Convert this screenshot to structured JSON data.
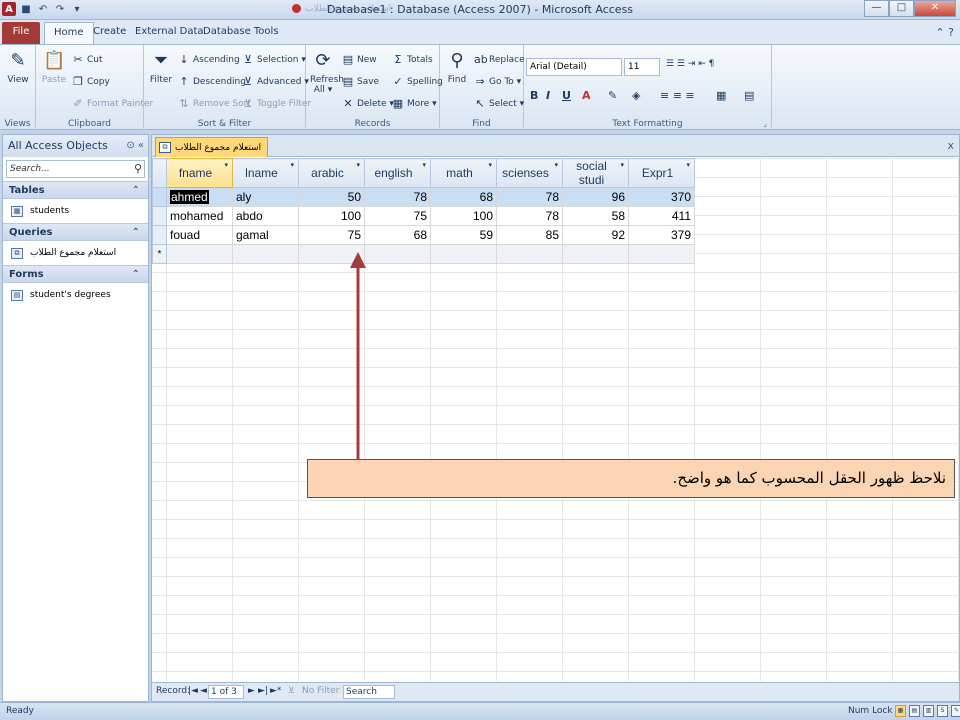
{
  "window": {
    "title": "Database1 : Database (Access 2007)  -  Microsoft Access",
    "title_ghost": "استعلام مجموع الطلاب",
    "min_glyph": "—",
    "max_glyph": "□",
    "close_glyph": "✕"
  },
  "tabs": {
    "file": "File",
    "home": "Home",
    "create": "Create",
    "external": "External Data",
    "dbtools": "Database Tools"
  },
  "ribbon": {
    "views": {
      "view": "View",
      "group": "Views"
    },
    "clipboard": {
      "paste": "Paste",
      "cut": "Cut",
      "copy": "Copy",
      "format_painter": "Format Painter",
      "group": "Clipboard"
    },
    "sort_filter": {
      "filter": "Filter",
      "ascending": "Ascending",
      "descending": "Descending",
      "remove_sort": "Remove Sort",
      "selection": "Selection ▾",
      "advanced": "Advanced ▾",
      "toggle_filter": "Toggle Filter",
      "group": "Sort & Filter"
    },
    "records": {
      "refresh": "Refresh",
      "refresh_all": "All ▾",
      "new": "New",
      "save": "Save",
      "delete": "Delete ▾",
      "totals": "Totals",
      "spelling": "Spelling",
      "more": "More ▾",
      "group": "Records"
    },
    "find": {
      "find": "Find",
      "replace": "Replace",
      "goto": "Go To ▾",
      "select": "Select ▾",
      "group": "Find"
    },
    "text_formatting": {
      "font": "Arial (Detail)",
      "size": "11",
      "group": "Text Formatting"
    }
  },
  "nav": {
    "header": "All Access Objects",
    "search_placeholder": "Search...",
    "categories": [
      {
        "label": "Tables",
        "items": [
          "students"
        ]
      },
      {
        "label": "Queries",
        "items": [
          "استعلام مجموع الطلاب"
        ]
      },
      {
        "label": "Forms",
        "items": [
          "student's degrees"
        ]
      }
    ]
  },
  "document": {
    "tab_label": "استعلام مجموع الطلاب",
    "close_glyph": "x",
    "columns": [
      "fname",
      "lname",
      "arabic",
      "english",
      "math",
      "scienses",
      "social studi",
      "Expr1"
    ],
    "rows": [
      [
        "ahmed",
        "aly",
        "50",
        "78",
        "68",
        "78",
        "96",
        "370"
      ],
      [
        "mohamed",
        "abdo",
        "100",
        "75",
        "100",
        "78",
        "58",
        "411"
      ],
      [
        "fouad",
        "gamal",
        "75",
        "68",
        "59",
        "85",
        "92",
        "379"
      ]
    ],
    "new_row_marker": "*"
  },
  "record_nav": {
    "label": "Record:",
    "position": "1 of 3",
    "no_filter": "No Filter",
    "search": "Search",
    "first": "|◄",
    "prev": "◄",
    "next": "►",
    "last": "►|",
    "new": "►*"
  },
  "annotation": "نلاحظ ظهور الحقل المحسوب كما هو واضح.",
  "status": {
    "ready": "Ready",
    "num_lock": "Num Lock"
  },
  "colors": {
    "accent_file_tab": "#a33a36",
    "callout_fill": "#fbd4b4",
    "arrow": "#a53c3c",
    "selected_header": "#ffe08c"
  }
}
